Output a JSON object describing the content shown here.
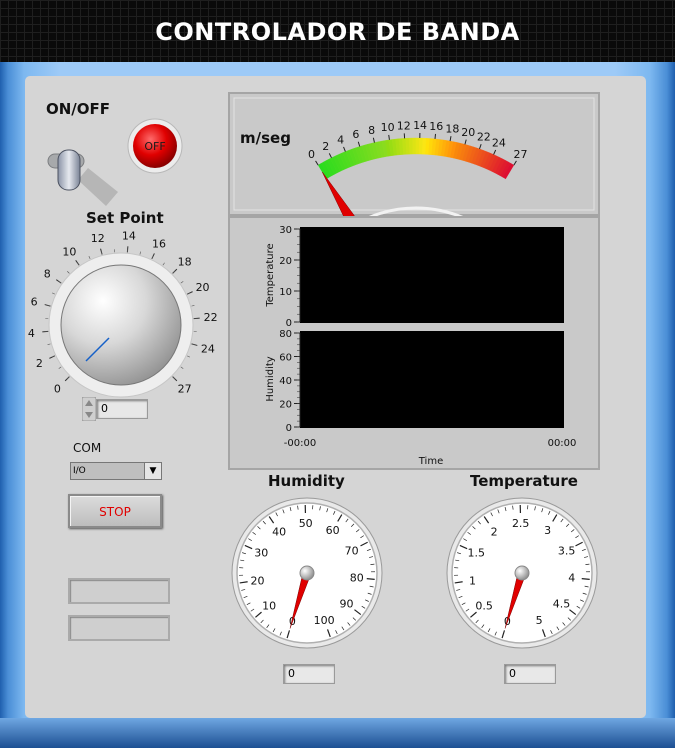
{
  "app": {
    "title": "CONTROLADOR DE BANDA"
  },
  "power": {
    "label": "ON/OFF",
    "led_text": "OFF",
    "state": "off"
  },
  "setpoint": {
    "label": "Set Point",
    "ticks": [
      "0",
      "2",
      "4",
      "6",
      "8",
      "10",
      "12",
      "14",
      "16",
      "18",
      "20",
      "22",
      "24",
      "27"
    ],
    "value": "0"
  },
  "com": {
    "label": "COM",
    "value": "I/O"
  },
  "stop_button": {
    "label": "STOP"
  },
  "speed_meter": {
    "unit_label": "m/seg",
    "ticks": [
      "0",
      "2",
      "4",
      "6",
      "8",
      "10",
      "12",
      "14",
      "16",
      "18",
      "20",
      "22",
      "24",
      "27"
    ],
    "value": 0
  },
  "chart": {
    "xlabel": "Time",
    "x_tick_start": "-00:00",
    "x_tick_end": "00:00",
    "temperature_plot": {
      "ylabel": "Temperature",
      "y_ticks": [
        "30",
        "20",
        "10",
        "0"
      ]
    },
    "humidity_plot": {
      "ylabel": "Humidity",
      "y_ticks": [
        "80",
        "60",
        "40",
        "20",
        "0"
      ]
    }
  },
  "humidity_gauge": {
    "label": "Humidity",
    "ticks": [
      "0",
      "10",
      "20",
      "30",
      "40",
      "50",
      "60",
      "70",
      "80",
      "90",
      "100"
    ],
    "value": "0"
  },
  "temperature_gauge": {
    "label": "Temperature",
    "ticks": [
      "0",
      "0.5",
      "1",
      "1.5",
      "2",
      "2.5",
      "3",
      "3.5",
      "4",
      "4.5",
      "5"
    ],
    "value": "0"
  },
  "colors": {
    "led_red": "#e00000",
    "needle_red": "#e00000",
    "plot_bg": "#000000",
    "title_bg": "#0a0a0a",
    "frame_blue": "#9dcaf7"
  }
}
